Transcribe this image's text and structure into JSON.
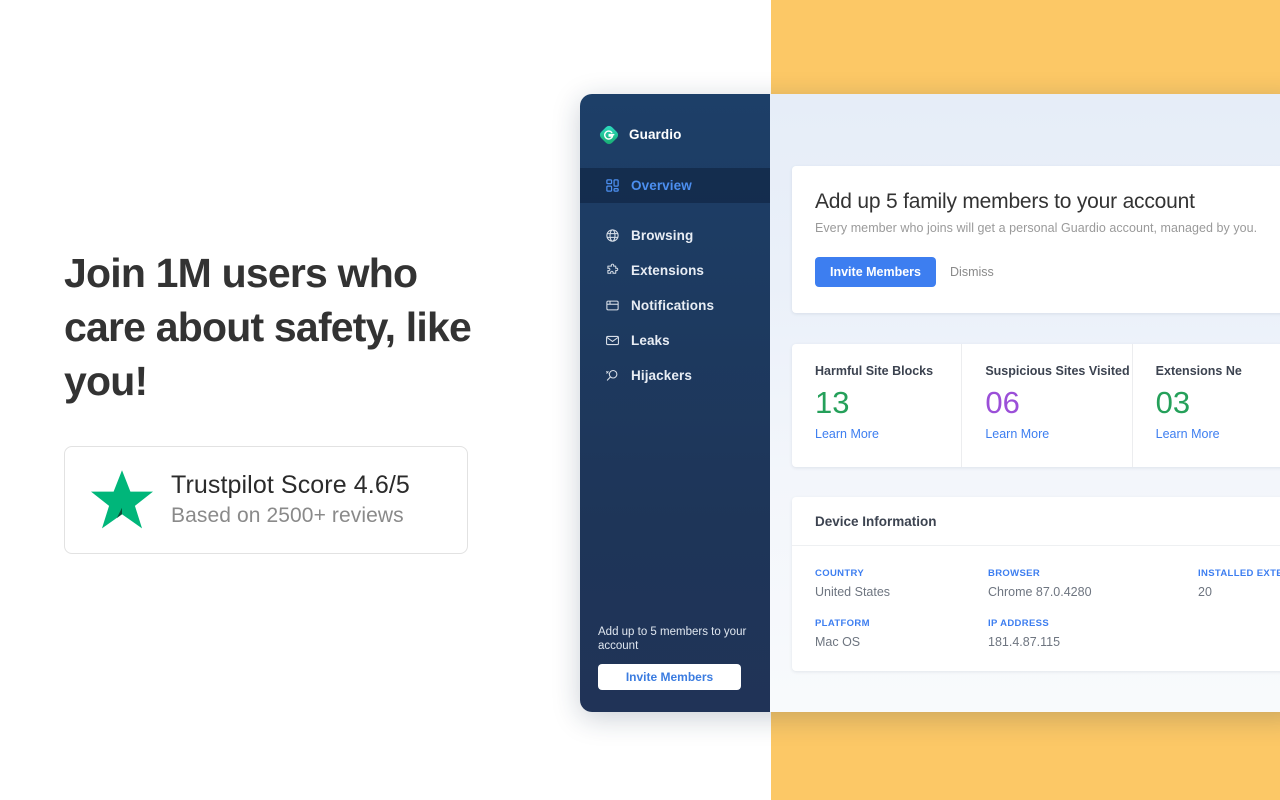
{
  "marketing": {
    "headline": "Join 1M users who care about safety, like you!",
    "trustpilot": {
      "icon": "star-icon",
      "score_text": "Trustpilot Score 4.6/5",
      "reviews_text": "Based on 2500+ reviews",
      "star_color": "#00b67a"
    }
  },
  "colors": {
    "backdrop_yellow": "#fcc866",
    "sidebar_top": "#1d3f68",
    "sidebar_bottom": "#203357",
    "accent_blue": "#3d7ef0",
    "active_nav_blue": "#4c8ff0",
    "stat_green": "#25a05a",
    "stat_purple": "#9b4fd8"
  },
  "app": {
    "sidebar": {
      "brand": {
        "name": "Guardio",
        "logo_icon": "guardio-shield-logo"
      },
      "items": [
        {
          "label": "Overview",
          "icon": "grid-icon",
          "active": true
        },
        {
          "label": "Browsing",
          "icon": "globe-icon",
          "active": false
        },
        {
          "label": "Extensions",
          "icon": "puzzle-piece-icon",
          "active": false
        },
        {
          "label": "Notifications",
          "icon": "browser-window-icon",
          "active": false
        },
        {
          "label": "Leaks",
          "icon": "envelope-icon",
          "active": false
        },
        {
          "label": "Hijackers",
          "icon": "search-person-icon",
          "active": false
        }
      ],
      "footer": {
        "text": "Add up to 5 members to your account",
        "invite_label": "Invite Members"
      }
    },
    "banner": {
      "title": "Add up 5 family members to your account",
      "subtitle": "Every member who joins will get a personal Guardio account, managed by you.",
      "primary_label": "Invite Members",
      "dismiss_label": "Dismiss"
    },
    "stats": [
      {
        "label": "Harmful Site Blocks",
        "value": "13",
        "color": "#25a05a",
        "link": "Learn More"
      },
      {
        "label": "Suspicious Sites Visited",
        "value": "06",
        "color": "#9b4fd8",
        "link": "Learn More"
      },
      {
        "label": "Extensions Ne",
        "value": "03",
        "color": "#25a05a",
        "link": "Learn More"
      }
    ],
    "device": {
      "title": "Device Information",
      "fields": [
        {
          "label": "COUNTRY",
          "value": "United States"
        },
        {
          "label": "BROWSER",
          "value": "Chrome 87.0.4280"
        },
        {
          "label": "INSTALLED EXTENS",
          "value": "20"
        },
        {
          "label": "PLATFORM",
          "value": "Mac OS"
        },
        {
          "label": "IP ADDRESS",
          "value": "181.4.87.115"
        },
        {
          "label": "",
          "value": ""
        }
      ]
    }
  }
}
